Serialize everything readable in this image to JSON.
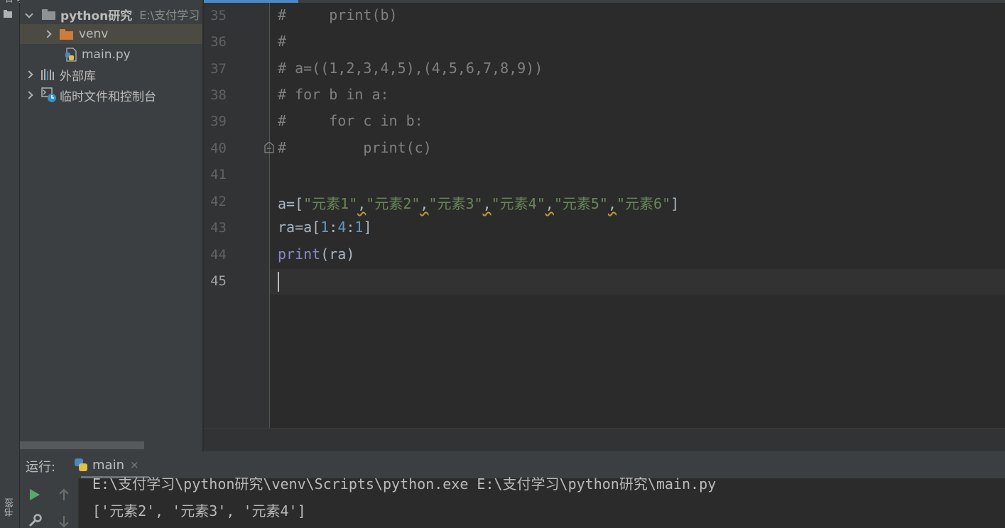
{
  "side_strip": {
    "top_tab": "项目",
    "bottom_tab": "书签"
  },
  "project_tree": {
    "root_name": "python研究",
    "root_path": "E:\\支付学习",
    "items": [
      {
        "label": "venv"
      },
      {
        "label": "main.py"
      },
      {
        "label": "外部库"
      },
      {
        "label": "临时文件和控制台"
      }
    ]
  },
  "editor": {
    "line_numbers": [
      "35",
      "36",
      "37",
      "38",
      "39",
      "40",
      "41",
      "42",
      "43",
      "44",
      "45"
    ],
    "lines": {
      "l35": "#     print(b)",
      "l36": "#",
      "l37": "# a=((1,2,3,4,5),(4,5,6,7,8,9))",
      "l38": "# for b in a:",
      "l39": "#     for c in b:",
      "l40": "#         print(c)",
      "l42": {
        "p0": "a=[",
        "s1": "\"元素1\"",
        "s2": "\"元素2\"",
        "s3": "\"元素3\"",
        "s4": "\"元素4\"",
        "s5": "\"元素5\"",
        "s6": "\"元素6\"",
        "comma": ",",
        "end": "]"
      },
      "l43": {
        "p0": "ra=a[",
        "n1": "1",
        "c1": ":",
        "n2": "4",
        "c2": ":",
        "n3": "1",
        "end": "]"
      },
      "l44": {
        "fn": "print",
        "args": "(ra)"
      }
    }
  },
  "run_panel": {
    "label": "运行:",
    "tab": "main",
    "close": "×",
    "output": [
      "E:\\支付学习\\python研究\\venv\\Scripts\\python.exe E:\\支付学习\\python研究\\main.py",
      "['元素2', '元素3', '元素4']"
    ]
  },
  "colors": {
    "accent": "#4a88c7",
    "comment": "#808080",
    "string": "#6a8759",
    "number": "#6897bb",
    "builtin": "#8888c6"
  }
}
